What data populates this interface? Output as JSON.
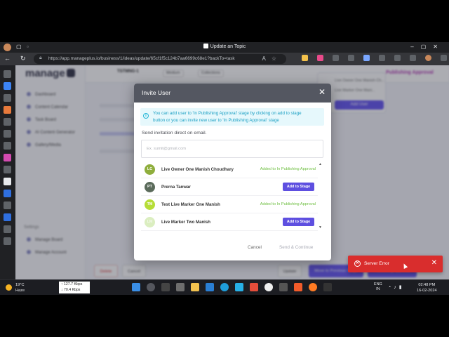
{
  "browser": {
    "tab_title": "Update an Topic",
    "url": "https://app.manageplus.io/business/1/ideas/update/65cf1f5c124b7aa6699c68e1?backTo=task"
  },
  "app": {
    "logo_text": "manage",
    "sidebar_items": [
      "Dashboard",
      "Content Calendar",
      "Task Board",
      "AI Content Generator",
      "Gallery/Media"
    ],
    "settings_heading": "Settings",
    "settings_items": [
      "Manage Board",
      "Manage Account"
    ],
    "header_title": "TSTMNG-1",
    "header_pill_1": "Medium",
    "header_pill_2": "Collections",
    "stage_label": "Publishing Approval",
    "dropdown_line_1": "Live Owner One Manish Ch...",
    "dropdown_line_2": "Live Marker One Mani...",
    "dropdown_button": "Add User",
    "bottom_buttons": [
      "Delete",
      "Cancel",
      "Update",
      "Move to Previous Stage",
      "Publishing Approval"
    ]
  },
  "modal": {
    "title": "Invite User",
    "info_line_1": "You can add user to 'In Publishing Approval' stage by clicking on add to stage",
    "info_line_2": "button or you can invite new user to 'In Publishing Approval' stage",
    "email_label": "Send invitation direct on email.",
    "email_placeholder": "Ex. sumit@gmail.com",
    "users": [
      {
        "initials": "LC",
        "name": "Live Owner One Manish Choudhary",
        "status": "Added to In Publishing Approval",
        "color": "#8fae3c"
      },
      {
        "initials": "PT",
        "name": "Prerna Tanwar",
        "action": "Add to Stage",
        "color": "#5b6b5b"
      },
      {
        "initials": "TM",
        "name": "Test Live Marker One Manish",
        "status": "Added to In Publishing Approval",
        "color": "#b6dd37"
      },
      {
        "initials": "LM",
        "name": "Live Marker Two Manish",
        "action": "Add to Stage",
        "color": "#dbeec0"
      }
    ],
    "cancel_label": "Cancel",
    "send_label": "Send & Continue"
  },
  "toast": {
    "message": "Server Error",
    "color": "#d92d2d"
  },
  "taskbar": {
    "weather_temp": "19°C",
    "weather_desc": "Haze",
    "net_up": "↑ 127.7 Kbps",
    "net_down": "↓ 70.4 Kbps",
    "lang_1": "ENG",
    "lang_2": "IN",
    "time": "02:48 PM",
    "date": "16-02-2024"
  }
}
